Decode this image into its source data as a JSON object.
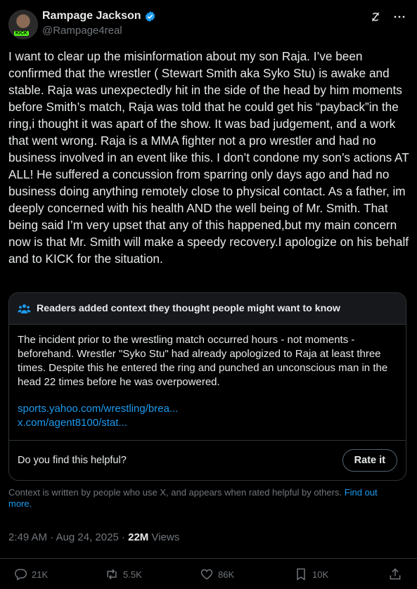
{
  "author": {
    "display_name": "Rampage Jackson",
    "handle": "@Rampage4real",
    "avatar_badge": "KICK"
  },
  "header_icons": [
    "grok-icon",
    "more-icon"
  ],
  "tweet": {
    "text": "I want to clear up the misinformation about my son Raja. I’ve been confirmed that the wrestler ( Stewart Smith aka Syko Stu) is awake and stable. Raja was unexpectedly hit in the side of the head by him moments before Smith’s match, Raja was told that he could get his “payback”in the ring,i thought it was apart of the show. It was bad judgement, and a work that went wrong. Raja is a MMA fighter not a pro wrestler and had no business involved in an event like this. I don’t condone my son’s actions AT ALL! He suffered a concussion from sparring only days ago and had no business doing anything remotely close to physical contact. As a father, im deeply concerned with his health AND the well being of Mr. Smith. That being said I’m very upset that any of this happened,but my main concern now is that Mr. Smith will make a speedy recovery.I apologize on his behalf and to KICK for the situation."
  },
  "community_note": {
    "title": "Readers added context they thought people might want to know",
    "body": "The incident prior to the wrestling match occurred hours - not moments - beforehand. Wrestler \"Syko Stu\" had already apologized to Raja at least three times. Despite this he entered the ring and punched an unconscious man in the head 22 times before he was overpowered.",
    "links": [
      "sports.yahoo.com/wrestling/brea...",
      "x.com/agent8100/stat..."
    ],
    "question": "Do you find this helpful?",
    "rate_label": "Rate it"
  },
  "disclaimer": {
    "text": "Context is written by people who use X, and appears when rated helpful by others.",
    "link": "Find out more."
  },
  "meta": {
    "time": "2:49 AM · Aug 24, 2025 · ",
    "views_count": "22M",
    "views_label": " Views"
  },
  "actions": {
    "replies": "21K",
    "reposts": "5.5K",
    "likes": "86K",
    "bookmarks": "10K"
  },
  "colors": {
    "background": "#000000",
    "text": "#e7e9ea",
    "muted": "#71767b",
    "link": "#1d9bf0",
    "verified": "#1d9bf0"
  }
}
